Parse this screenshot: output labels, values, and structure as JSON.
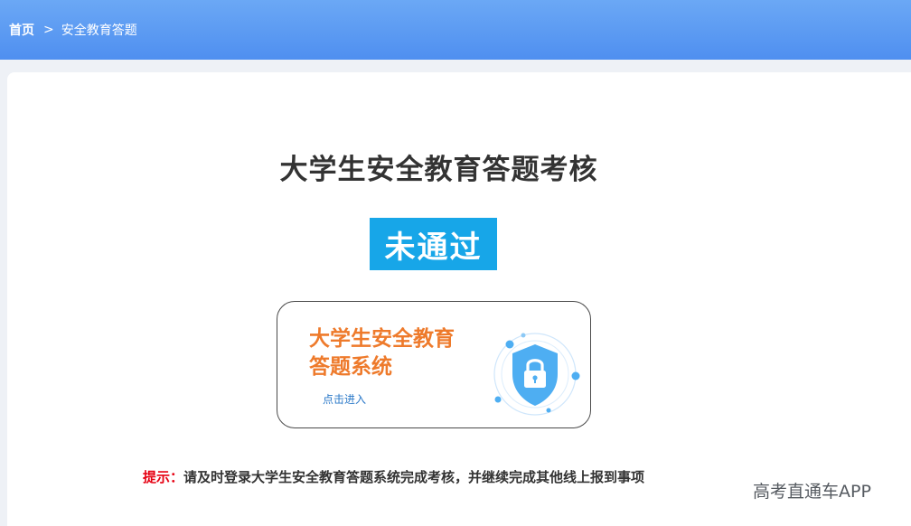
{
  "breadcrumb": {
    "home": "首页",
    "separator": ">",
    "current": "安全教育答题"
  },
  "main": {
    "title": "大学生安全教育答题考核",
    "status": "未通过",
    "system_card": {
      "name_line1": "大学生安全教育",
      "name_line2": "答题系统",
      "enter_link": "点击进入",
      "icon": "shield-lock-icon"
    },
    "tip": {
      "label": "提示：",
      "text": "请及时登录大学生安全教育答题系统完成考核，并继续完成其他线上报到事项"
    }
  },
  "watermark": "高考直通车APP",
  "colors": {
    "header_start": "#6ba8f5",
    "header_end": "#4f8ff0",
    "status_bg": "#17a6e8",
    "system_name": "#ee7a2b",
    "tip_label": "#e60012",
    "shield": "#4eaef2"
  }
}
